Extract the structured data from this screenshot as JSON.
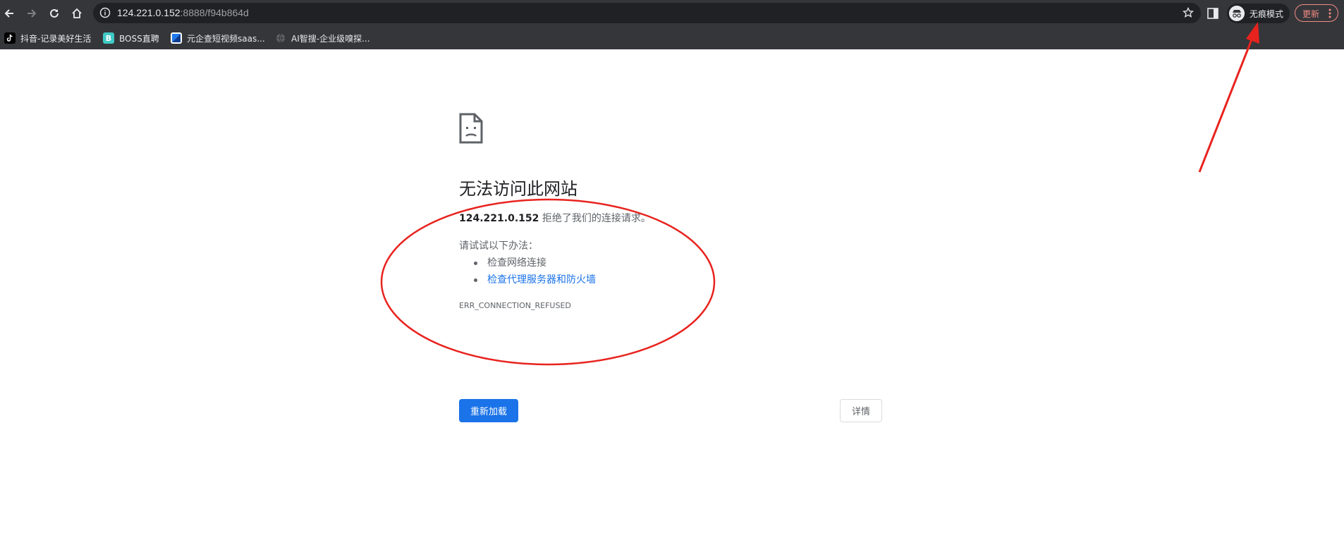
{
  "toolbar": {
    "url_host": "124.221.0.152",
    "url_rest": ":8888/f94b864d",
    "incognito_label": "无痕模式",
    "update_label": "更新"
  },
  "bookmarks": [
    {
      "label": "抖音-记录美好生活",
      "icon": "tiktok-icon"
    },
    {
      "label": "BOSS直聘",
      "icon": "boss-icon",
      "icon_text": "B"
    },
    {
      "label": "元企查短视频saas...",
      "icon": "bookmark-app-icon"
    },
    {
      "label": "AI智搜-企业级嗅探...",
      "icon": "globe-icon"
    }
  ],
  "error": {
    "title": "无法访问此网站",
    "host": "124.221.0.152",
    "message": " 拒绝了我们的连接请求。",
    "suggest_heading": "请试试以下办法：",
    "suggestions": [
      {
        "text": "检查网络连接",
        "link": false
      },
      {
        "text": "检查代理服务器和防火墙",
        "link": true
      }
    ],
    "code": "ERR_CONNECTION_REFUSED",
    "reload_label": "重新加载",
    "details_label": "详情"
  },
  "colors": {
    "chrome_bg": "#35363a",
    "omnibox_bg": "#202124",
    "accent": "#1a73e8",
    "annotation": "#e8231e"
  }
}
